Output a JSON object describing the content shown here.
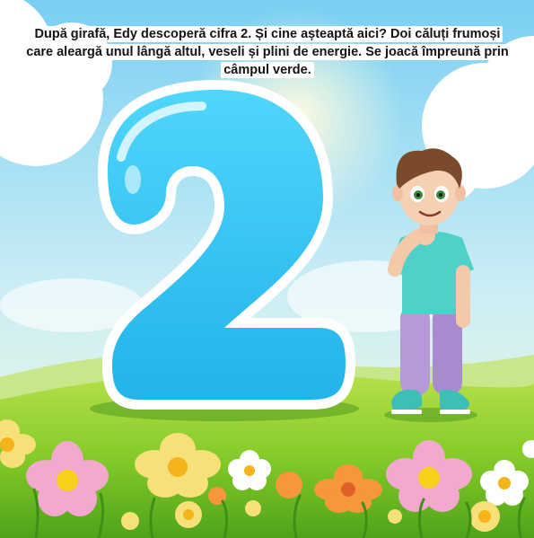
{
  "story": {
    "text": "După girafă, Edy descoperă cifra 2. Și cine așteaptă aici? Doi căluți frumoși care aleargă unul lângă altul, veseli și plini de energie. Se joacă împreună prin câmpul verde."
  },
  "illustration": {
    "digit": "2",
    "colors": {
      "sky_top": "#7fd3f3",
      "sky_bottom": "#e8f7d8",
      "grass": "#8fd12a",
      "digit_fill": "#36c4f0",
      "digit_outline": "#ffffff",
      "shirt": "#4fd0c9",
      "pants": "#b69ad8"
    }
  }
}
